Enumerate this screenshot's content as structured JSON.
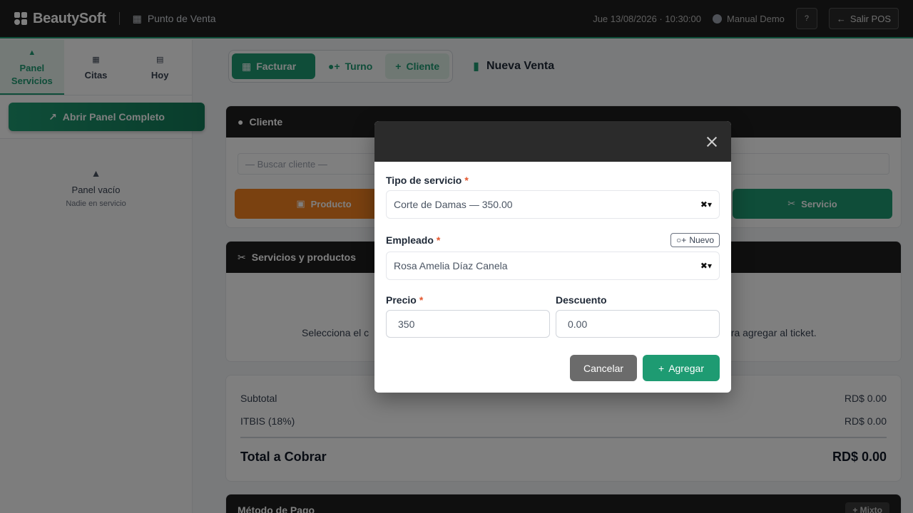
{
  "topbar": {
    "brand": "BeautySoft",
    "section": "Punto de Venta",
    "datetime": "Jue 13/08/2026 · 10:30:00",
    "user": "Manual Demo",
    "help_icon": "question-icon",
    "exit_label": "Salir POS"
  },
  "sidebar": {
    "tabs": [
      {
        "label": "Panel Servicios",
        "icon": "bell-icon",
        "active": true
      },
      {
        "label": "Citas",
        "icon": "calendar-icon",
        "active": false
      },
      {
        "label": "Hoy",
        "icon": "list-icon",
        "active": false
      }
    ],
    "open_button": "Abrir Panel Completo",
    "empty_title": "Panel vacío",
    "empty_subtitle": "Nadie en servicio"
  },
  "toolbar": {
    "facturar": "Facturar",
    "turno": "Turno",
    "cliente": "Cliente",
    "page_title": "Nueva Venta"
  },
  "cliente_card": {
    "title": "Cliente",
    "search_placeholder": "— Buscar cliente —",
    "producto_button": "Producto",
    "servicio_button": "Servicio"
  },
  "servicios_card": {
    "title": "Servicios y productos",
    "empty_left": "Selecciona el c",
    "empty_right": "ara agregar al ticket."
  },
  "totals": {
    "subtotal_label": "Subtotal",
    "subtotal_value": "RD$ 0.00",
    "itbis_label": "ITBIS (18%)",
    "itbis_value": "RD$ 0.00",
    "total_label": "Total a Cobrar",
    "total_value": "RD$ 0.00"
  },
  "pago_card": {
    "title": "Método de Pago",
    "mixto": "+ Mixto"
  },
  "modal": {
    "tipo_label": "Tipo de servicio",
    "tipo_value": "Corte de Damas — 350.00",
    "empleado_label": "Empleado",
    "nuevo_label": "Nuevo",
    "empleado_value": "Rosa Amelia Díaz Canela",
    "precio_label": "Precio",
    "precio_value": "350",
    "descuento_label": "Descuento",
    "descuento_value": "0.00",
    "cancel_label": "Cancelar",
    "add_label": "Agregar",
    "required_mark": "*"
  },
  "colors": {
    "accent": "#1e9b72",
    "orange": "#f58220",
    "dark": "#1f1f1f"
  }
}
